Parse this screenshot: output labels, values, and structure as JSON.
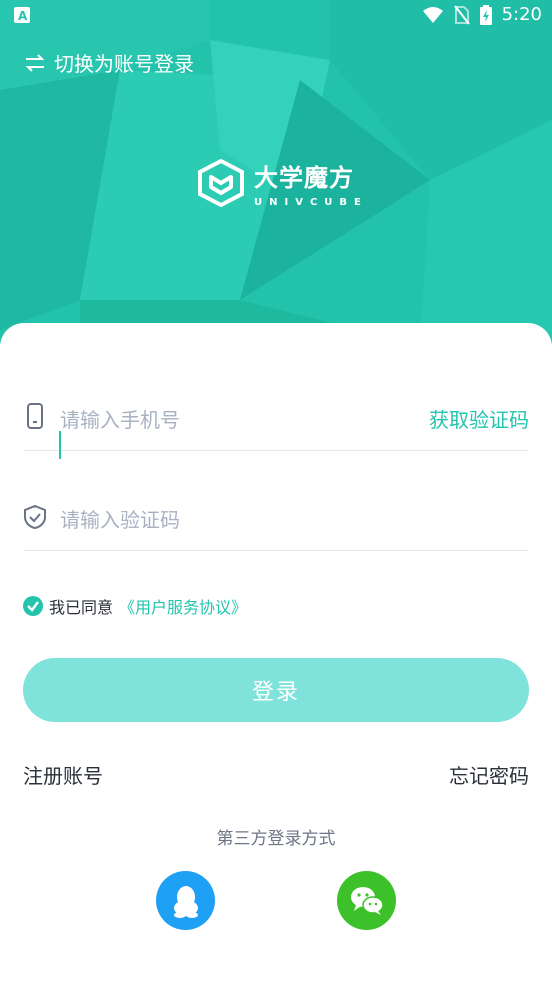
{
  "status_bar": {
    "time": "5:20"
  },
  "header": {
    "switch_label": "切换为账号登录",
    "logo_cn": "大学魔方",
    "logo_en": "UNIVCUBE"
  },
  "form": {
    "phone_placeholder": "请输入手机号",
    "get_code_label": "获取验证码",
    "code_placeholder": "请输入验证码",
    "agree_text": "我已同意",
    "agreement_link": "《用户服务协议》",
    "login_label": "登录"
  },
  "links": {
    "register": "注册账号",
    "forgot_password": "忘记密码"
  },
  "third_party": {
    "title": "第三方登录方式",
    "providers": [
      "qq-icon",
      "wechat-icon"
    ]
  },
  "colors": {
    "accent": "#23c4ad",
    "button_disabled": "#7fe3db",
    "qq": "#1ea0f4",
    "wechat": "#3cc12a"
  }
}
